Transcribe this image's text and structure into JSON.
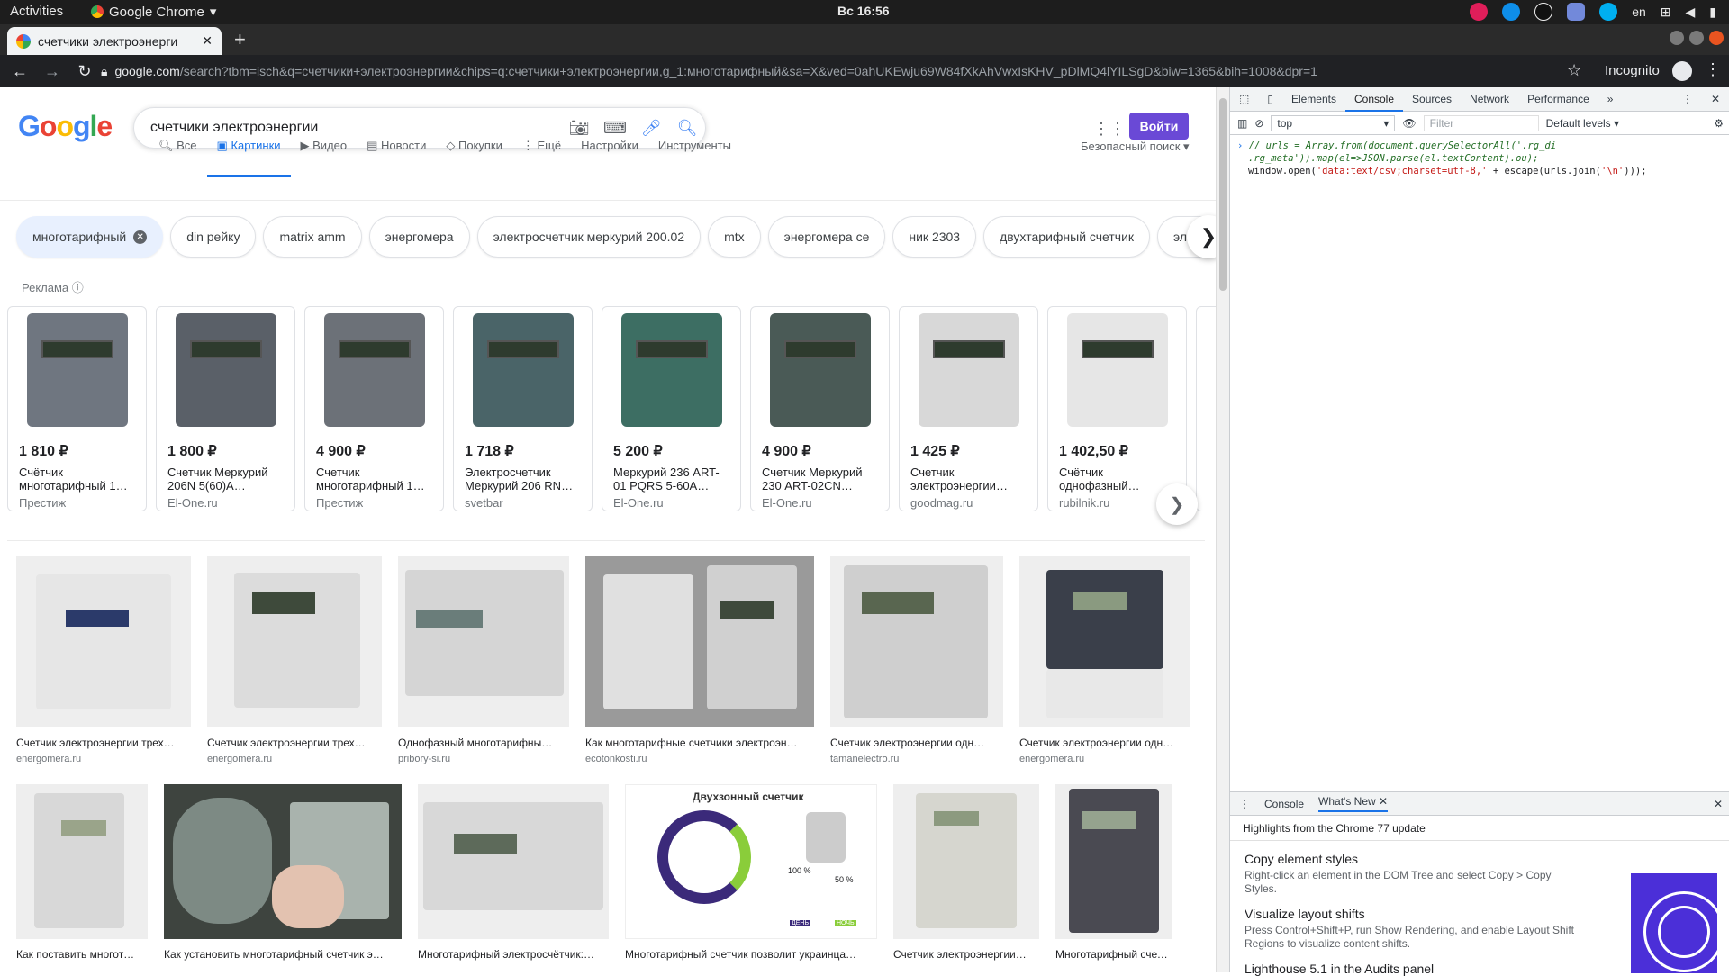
{
  "os": {
    "activities": "Activities",
    "app": "Google Chrome",
    "clock": "Вс 16:56",
    "lang": "en"
  },
  "tab": {
    "title": "счетчики электроэнерги"
  },
  "url": {
    "host": "google.com",
    "path": "/search?tbm=isch&q=счетчики+электроэнергии&chips=q:счетчики+электроэнергии,g_1:многотарифный&sa=X&ved=0ahUKEwju69W84fXkAhVwxIsKHV_pDlMQ4lYILSgD&biw=1365&bih=1008&dpr=1",
    "incognito": "Incognito"
  },
  "google": {
    "logo": [
      "G",
      "o",
      "o",
      "g",
      "l",
      "e"
    ],
    "query": "счетчики электроэнергии",
    "signin": "Войти",
    "tabs": [
      "Все",
      "Картинки",
      "Видео",
      "Новости",
      "Покупки",
      "Ещё",
      "Настройки",
      "Инструменты"
    ],
    "safe_search": "Безопасный поиск",
    "chips": [
      "многотарифный",
      "din рейку",
      "matrix amm",
      "энергомера",
      "электросчетчик меркурий 200.02",
      "mtx",
      "энергомера ce",
      "ник 2303",
      "двухтарифный счетчик",
      "электр"
    ],
    "ads_label": "Реклама",
    "ads": [
      {
        "price": "1 810 ₽",
        "name": "Счётчик многотарифный 1…",
        "store": "Престиж",
        "color": "#6f7680"
      },
      {
        "price": "1 800 ₽",
        "name": "Счетчик Меркурий 206N 5(60)A…",
        "store": "El-One.ru",
        "color": "#5a6068"
      },
      {
        "price": "4 900 ₽",
        "name": "Счетчик многотарифный 1…",
        "store": "Престиж",
        "color": "#6c7178"
      },
      {
        "price": "1 718 ₽",
        "name": "Электросчетчик Меркурий 206 RN…",
        "store": "svetbar",
        "color": "#4a6468"
      },
      {
        "price": "5 200 ₽",
        "name": "Меркурий 236 ART-01 PQRS 5-60A…",
        "store": "El-One.ru",
        "color": "#3d6e63"
      },
      {
        "price": "4 900 ₽",
        "name": "Счетчик Меркурий 230 ART-02CN…",
        "store": "El-One.ru",
        "color": "#4a5a56"
      },
      {
        "price": "1 425 ₽",
        "name": "Счетчик электроэнергии…",
        "store": "goodmag.ru",
        "color": "#d8d8d8"
      },
      {
        "price": "1 402,50 ₽",
        "name": "Счётчик однофазный…",
        "store": "rubilnik.ru",
        "color": "#e6e6e6"
      }
    ],
    "row1": [
      {
        "cap": "Счетчик электроэнергии трех…",
        "src": "energomera.ru"
      },
      {
        "cap": "Счетчик электроэнергии трех…",
        "src": "energomera.ru"
      },
      {
        "cap": "Однофазный многотарифны…",
        "src": "pribory-si.ru"
      },
      {
        "cap": "Как многотарифные счетчики электроэн…",
        "src": "ecotonkosti.ru"
      },
      {
        "cap": "Счетчик электроэнергии одн…",
        "src": "tamanelectro.ru"
      },
      {
        "cap": "Счетчик электроэнергии одн…",
        "src": "energomera.ru"
      }
    ],
    "row2": [
      {
        "cap": "Как поставить многот…"
      },
      {
        "cap": "Как установить многотарифный счетчик э…"
      },
      {
        "cap": "Многотарифный электросчётчик:…"
      },
      {
        "cap": "Многотарифный счетчик позволит украинца…",
        "inner_title": "Двухзонный счетчик",
        "day": "ДЕНЬ",
        "night": "НОЧЬ",
        "pct1": "100 %",
        "pct2": "50 %"
      },
      {
        "cap": "Счетчик электроэнергии…"
      },
      {
        "cap": "Многотарифный счет…"
      }
    ]
  },
  "devtools": {
    "tabs": [
      "Elements",
      "Console",
      "Sources",
      "Network",
      "Performance"
    ],
    "context": "top",
    "filter_placeholder": "Filter",
    "levels": "Default levels",
    "code1": "// urls = Array.from(document.querySelectorAll('.rg_di",
    "code2": ".rg_meta')).map(el=>JSON.parse(el.textContent).ou);",
    "code3a": "window.open(",
    "code3b": "'data:text/csv;charset=utf-8,'",
    "code3c": " + escape(urls.join(",
    "code3d": "'\\n'",
    "code3e": ")));",
    "drawer_tabs": [
      "Console",
      "What's New"
    ],
    "highlights": "Highlights from the Chrome 77 update",
    "news": [
      {
        "h": "Copy element styles",
        "d": "Right-click an element in the DOM Tree and select Copy > Copy Styles."
      },
      {
        "h": "Visualize layout shifts",
        "d": "Press Control+Shift+P, run Show Rendering, and enable Layout Shift Regions to visualize content shifts."
      },
      {
        "h": "Lighthouse 5.1 in the Audits panel",
        "d": ""
      }
    ]
  }
}
